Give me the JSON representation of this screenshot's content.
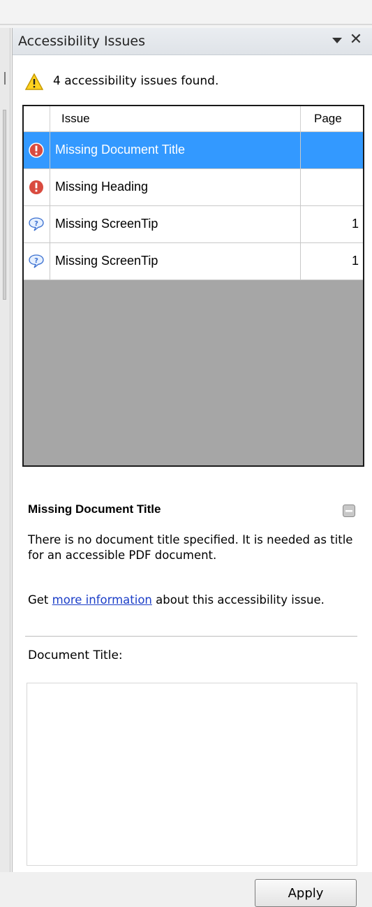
{
  "pane": {
    "title": "Accessibility Issues",
    "menu_icon": "triangle-down-icon",
    "close_label": "✕"
  },
  "summary": {
    "icon": "warning-icon",
    "text": "4 accessibility issues found."
  },
  "table": {
    "headers": {
      "issue": "Issue",
      "page": "Page"
    },
    "rows": [
      {
        "icon": "error-icon",
        "name": "Missing Document Title",
        "page": "",
        "selected": true
      },
      {
        "icon": "error-icon",
        "name": "Missing Heading",
        "page": "",
        "selected": false
      },
      {
        "icon": "tip-icon",
        "name": "Missing ScreenTip",
        "page": "1",
        "selected": false
      },
      {
        "icon": "tip-icon",
        "name": "Missing ScreenTip",
        "page": "1",
        "selected": false
      }
    ]
  },
  "detail": {
    "title": "Missing Document Title",
    "description": "There is no document title specified. It is needed as title for an accessible PDF document.",
    "more_prefix": "Get",
    "more_link": "more information",
    "more_suffix": "about this accessibility issue.",
    "field_label": "Document Title:",
    "field_value": "",
    "apply_label": "Apply"
  },
  "colors": {
    "selection": "#3399ff",
    "error": "#d94b3f",
    "link": "#1b3ec8"
  }
}
